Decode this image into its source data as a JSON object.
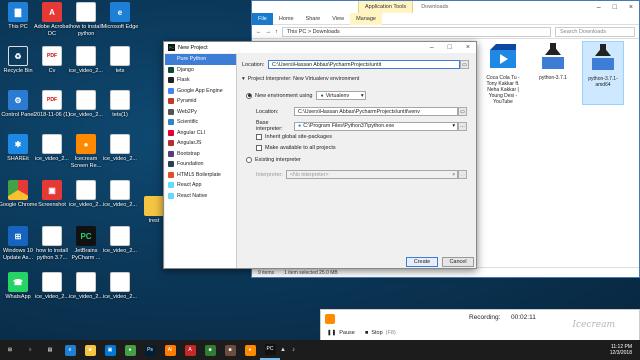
{
  "desktop": {
    "icons": [
      {
        "label": "This PC",
        "glyph": "▇",
        "cls": "g-edge"
      },
      {
        "label": "Adobe Acrobat DC",
        "glyph": "A",
        "cls": "g-shot"
      },
      {
        "label": "how to install python",
        "glyph": "",
        "cls": "g-doc"
      },
      {
        "label": "Microsoft Edge",
        "glyph": "e",
        "cls": "g-edge"
      },
      {
        "label": "Recycle Bin",
        "glyph": "♻",
        "cls": "g-bin"
      },
      {
        "label": "Cv",
        "glyph": "PDF",
        "cls": "g-pdf"
      },
      {
        "label": "ice_video_2...",
        "glyph": "",
        "cls": "g-doc"
      },
      {
        "label": "tets",
        "glyph": "",
        "cls": "g-doc"
      },
      {
        "label": "Control Panel",
        "glyph": "⚙",
        "cls": "g-panel"
      },
      {
        "label": "2018-11-06 (1)",
        "glyph": "PDF",
        "cls": "g-pdf"
      },
      {
        "label": "ice_video_2...",
        "glyph": "",
        "cls": "g-doc"
      },
      {
        "label": "tets(1)",
        "glyph": "",
        "cls": "g-doc"
      },
      {
        "label": "SHAREit",
        "glyph": "✱",
        "cls": "g-share"
      },
      {
        "label": "ice_video_2...",
        "glyph": "",
        "cls": "g-doc"
      },
      {
        "label": "Icecream Screen Re...",
        "glyph": "●",
        "cls": "g-ice"
      },
      {
        "label": "ice_video_2...",
        "glyph": "",
        "cls": "g-doc"
      },
      {
        "label": "Google Chrome",
        "glyph": "",
        "cls": "g-chrome"
      },
      {
        "label": "Screenshot",
        "glyph": "▣",
        "cls": "g-shot"
      },
      {
        "label": "ice_video_2...",
        "glyph": "",
        "cls": "g-doc"
      },
      {
        "label": "ice_video_2...",
        "glyph": "",
        "cls": "g-doc"
      },
      {
        "label": "trest",
        "glyph": "",
        "cls": "g-folder"
      },
      {
        "label": "Windows 10 Update As...",
        "glyph": "⊞",
        "cls": "g-win"
      },
      {
        "label": "how to install python 3.7...",
        "glyph": "",
        "cls": "g-doc"
      },
      {
        "label": "JetBrains PyCharm ...",
        "glyph": "PC",
        "cls": "g-pc"
      },
      {
        "label": "ice_video_2...",
        "glyph": "",
        "cls": "g-doc"
      },
      {
        "label": "WhatsApp",
        "glyph": "☎",
        "cls": "g-wa"
      },
      {
        "label": "ice_video_2...",
        "glyph": "",
        "cls": "g-doc"
      },
      {
        "label": "ice_video_2...",
        "glyph": "",
        "cls": "g-doc"
      },
      {
        "label": "ice_video_2...",
        "glyph": "",
        "cls": "g-doc"
      }
    ]
  },
  "explorer": {
    "app_tools": "Application Tools",
    "title": "Downloads",
    "tabs": [
      "File",
      "Home",
      "Share",
      "View",
      "Manage"
    ],
    "path": "This PC  >  Downloads",
    "search_placeholder": "Search Downloads",
    "files": [
      {
        "name": "Coca Cola Tu - Tony Kakkar ft. Neha Kakkar | Young Desi - YouTube"
      },
      {
        "name": "python-3.7.1"
      },
      {
        "name": "python-3.7.1-amd64"
      }
    ],
    "status": {
      "items": "9 items",
      "selected": "1 item selected  25.0 MB"
    }
  },
  "dialog": {
    "title": "New Project",
    "sidebar": [
      {
        "label": "Pure Python",
        "color": "#3d7dd6"
      },
      {
        "label": "Django",
        "color": "#0c4b33"
      },
      {
        "label": "Flask",
        "color": "#222222"
      },
      {
        "label": "Google App Engine",
        "color": "#4285f4"
      },
      {
        "label": "Pyramid",
        "color": "#c0392b"
      },
      {
        "label": "Web2Py",
        "color": "#555555"
      },
      {
        "label": "Scientific",
        "color": "#2e86c1"
      },
      {
        "label": "Angular CLI",
        "color": "#dd0031"
      },
      {
        "label": "AngularJS",
        "color": "#b52e31"
      },
      {
        "label": "Bootstrap",
        "color": "#563d7c"
      },
      {
        "label": "Foundation",
        "color": "#2c3e50"
      },
      {
        "label": "HTML5 Boilerplate",
        "color": "#e44d26"
      },
      {
        "label": "React App",
        "color": "#61dafb"
      },
      {
        "label": "React Native",
        "color": "#61dafb"
      }
    ],
    "location_label": "Location:",
    "location_value": "C:\\Users\\Hassan Abbas\\PycharmProjects\\untit",
    "interpreter_section": "Project Interpreter: New Virtualenv environment",
    "new_env_label": "New environment using",
    "env_tool": "Virtualenv",
    "env_location_label": "Location:",
    "env_location_value": "C:\\Users\\Hassan Abbas\\PycharmProjects\\untit\\venv",
    "base_interp_label": "Base interpreter:",
    "base_interp_value": "C:\\Program Files\\Python37\\python.exe",
    "inherit_label": "Inherit global site-packages",
    "available_label": "Make available to all projects",
    "existing_label": "Existing interpreter",
    "interpreter_label": "Interpreter:",
    "interpreter_value": "<No interpreter>",
    "create": "Create",
    "cancel": "Cancel"
  },
  "recorder": {
    "status": "Recording:",
    "time": "00:02:11",
    "pause": "Pause",
    "stop": "Stop",
    "stop_key": "(F8)",
    "watermark": "Icecream"
  },
  "taskbar": {
    "apps": [
      {
        "name": "start",
        "glyph": "⊞",
        "color": "transparent"
      },
      {
        "name": "search",
        "glyph": "○",
        "color": "transparent"
      },
      {
        "name": "taskview",
        "glyph": "▤",
        "color": "transparent"
      },
      {
        "name": "edge",
        "glyph": "e",
        "color": "#1e7fd6"
      },
      {
        "name": "explorer",
        "glyph": "■",
        "color": "#f4c542"
      },
      {
        "name": "store",
        "glyph": "▣",
        "color": "#0078d7"
      },
      {
        "name": "chrome",
        "glyph": "●",
        "color": "#43a047"
      },
      {
        "name": "photoshop",
        "glyph": "Ps",
        "color": "#001e36"
      },
      {
        "name": "illustrator",
        "glyph": "Ai",
        "color": "#ff7c00"
      },
      {
        "name": "acrobat",
        "glyph": "A",
        "color": "#c62828"
      },
      {
        "name": "app1",
        "glyph": "■",
        "color": "#2e7d32"
      },
      {
        "name": "app2",
        "glyph": "■",
        "color": "#6d4c41"
      },
      {
        "name": "icecream",
        "glyph": "●",
        "color": "#ff8a00"
      },
      {
        "name": "pycharm",
        "glyph": "PC",
        "color": "#111111"
      }
    ],
    "time": "11:12 PM",
    "date": "12/3/2018"
  }
}
